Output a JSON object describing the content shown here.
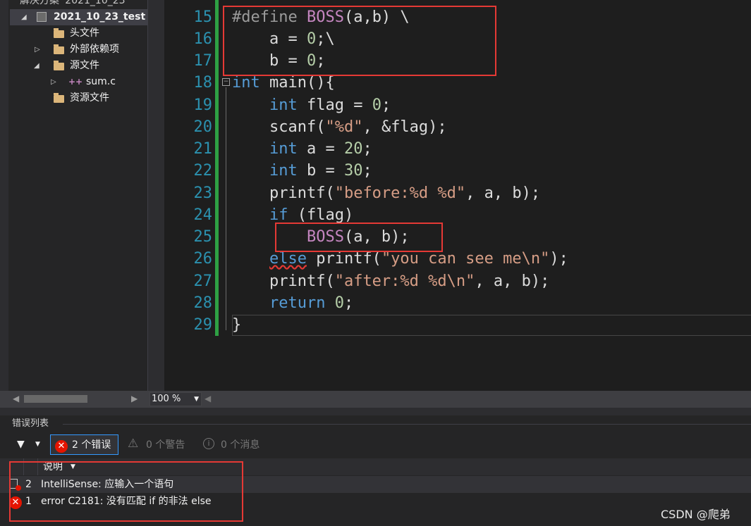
{
  "solution_explorer": {
    "solution_label": "解决方案 '2021_10_23",
    "project": "2021_10_23_test",
    "items": [
      {
        "label": "头文件"
      },
      {
        "label": "外部依赖项"
      },
      {
        "label": "源文件"
      },
      {
        "label": "sum.c"
      },
      {
        "label": "资源文件"
      }
    ]
  },
  "editor": {
    "zoom": "100 %",
    "lines": [
      {
        "n": "15"
      },
      {
        "n": "16"
      },
      {
        "n": "17"
      },
      {
        "n": "18"
      },
      {
        "n": "19"
      },
      {
        "n": "20"
      },
      {
        "n": "21"
      },
      {
        "n": "22"
      },
      {
        "n": "23"
      },
      {
        "n": "24"
      },
      {
        "n": "25"
      },
      {
        "n": "26"
      },
      {
        "n": "27"
      },
      {
        "n": "28"
      },
      {
        "n": "29"
      }
    ],
    "code": {
      "l15_a": "#define ",
      "l15_b": "BOSS",
      "l15_c": "(a,b) \\",
      "l16": "    a = ",
      "l16_n": "0",
      "l16_e": ";\\",
      "l17": "    b = ",
      "l17_n": "0",
      "l17_e": ";",
      "l18_kw": "int",
      "l18_e": " main(){",
      "l19_kw": "int",
      "l19_a": " flag = ",
      "l19_n": "0",
      "l19_e": ";",
      "l20_a": "scanf(",
      "l20_s": "\"%d\"",
      "l20_e": ", &flag);",
      "l21_kw": "int",
      "l21_a": " a = ",
      "l21_n": "20",
      "l21_e": ";",
      "l22_kw": "int",
      "l22_a": " b = ",
      "l22_n": "30",
      "l22_e": ";",
      "l23_a": "printf(",
      "l23_s": "\"before:%d %d\"",
      "l23_e": ", a, b);",
      "l24_kw": "if",
      "l24_e": " (flag)",
      "l25_m": "BOSS",
      "l25_e": "(a, b);",
      "l26_kw": "else",
      "l26_a": " printf(",
      "l26_s": "\"you can see me\\n\"",
      "l26_e": ");",
      "l27_a": "printf(",
      "l27_s": "\"after:%d %d\\n\"",
      "l27_e": ", a, b);",
      "l28_kw": "return",
      "l28_a": " ",
      "l28_n": "0",
      "l28_e": ";",
      "l29": "}"
    }
  },
  "error_list": {
    "title": "错误列表",
    "errors_btn": "2 个错误",
    "warnings_btn": "0 个警告",
    "messages_btn": "0 个消息",
    "column_header": "说明",
    "rows": [
      {
        "num": "2",
        "desc": "IntelliSense:  应输入一个语句"
      },
      {
        "num": "1",
        "desc": "error C2181: 没有匹配 if 的非法 else"
      }
    ]
  },
  "watermark": "CSDN @爬弟",
  "colors": {
    "keyword": "#569cd6",
    "string": "#d69d85",
    "macro": "#c586c0",
    "number": "#b5cea8",
    "highlight_box": "#e53935"
  }
}
